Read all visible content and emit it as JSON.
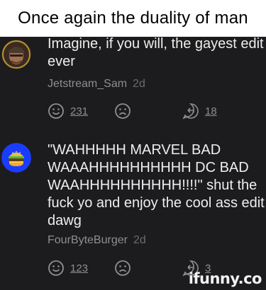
{
  "meme": {
    "caption": "Once again the duality of man"
  },
  "comments": [
    {
      "text": "Imagine, if you will, the gayest edit ever",
      "username": "Jetstream_Sam",
      "time": "2d",
      "smile_count": "231",
      "reply_count": "18",
      "avatar_icon": "soldier-avatar"
    },
    {
      "text": "\"WAHHHHH MARVEL BAD WAAAHHHHHHHHHH DC BAD WAAHHHHHHHHHH!!!!\" shut the fuck yo and enjoy the cool ass edit dawg",
      "username": "FourByteBurger",
      "time": "2d",
      "smile_count": "123",
      "reply_count": "3",
      "avatar_icon": "burger-avatar"
    }
  ],
  "watermark": {
    "text": "ifunny.co",
    "accent": "#ffcc00"
  },
  "colors": {
    "background": "#1c1c1e",
    "text": "#eeeeee",
    "muted": "#8e8e93",
    "burger_avatar_bg": "#1a3cff"
  }
}
